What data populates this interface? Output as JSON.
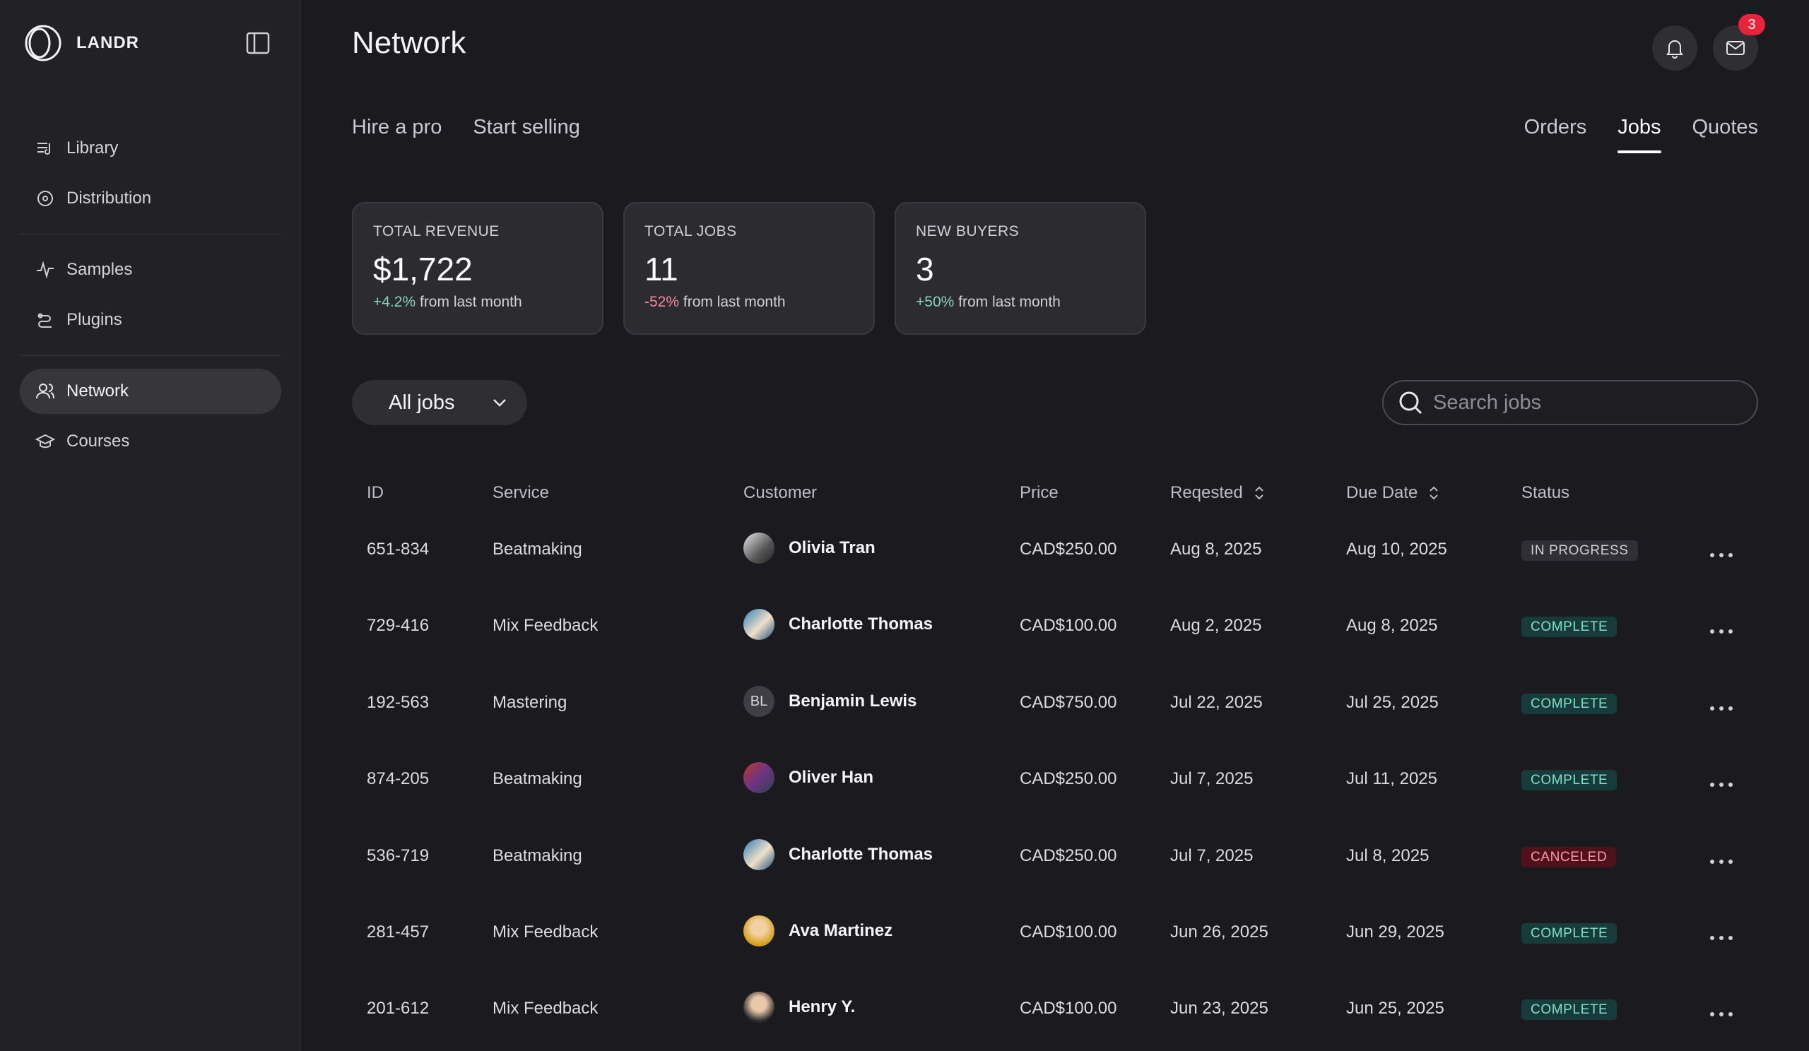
{
  "brand": {
    "name": "LANDR"
  },
  "sidebar": {
    "items": [
      {
        "label": "Library",
        "icon": "library-icon"
      },
      {
        "label": "Distribution",
        "icon": "distribution-icon"
      },
      {
        "label": "Samples",
        "icon": "samples-icon"
      },
      {
        "label": "Plugins",
        "icon": "plugins-icon"
      },
      {
        "label": "Network",
        "icon": "network-icon",
        "active": true
      },
      {
        "label": "Courses",
        "icon": "courses-icon"
      }
    ]
  },
  "header": {
    "title": "Network",
    "notifications_icon": "bell-icon",
    "messages_icon": "mail-icon",
    "messages_badge": "3"
  },
  "subnav": {
    "items": [
      "Hire a pro",
      "Start selling"
    ]
  },
  "tabs": {
    "items": [
      "Orders",
      "Jobs",
      "Quotes"
    ],
    "active": "Jobs"
  },
  "stats": [
    {
      "label": "TOTAL REVENUE",
      "value": "$1,722",
      "change": "+4.2%",
      "change_suffix": "from last month",
      "trend": "positive"
    },
    {
      "label": "TOTAL JOBS",
      "value": "11",
      "change": "-52%",
      "change_suffix": "from last month",
      "trend": "negative"
    },
    {
      "label": "NEW BUYERS",
      "value": "3",
      "change": "+50%",
      "change_suffix": "from last month",
      "trend": "positive"
    }
  ],
  "filter": {
    "selected": "All jobs"
  },
  "search": {
    "placeholder": "Search jobs",
    "value": ""
  },
  "table": {
    "headers": {
      "id": "ID",
      "service": "Service",
      "customer": "Customer",
      "price": "Price",
      "requested": "Reqested",
      "due": "Due Date",
      "status": "Status"
    },
    "rows": [
      {
        "id": "651-834",
        "service": "Beatmaking",
        "customer": "Olivia Tran",
        "avatar": "photo",
        "price": "CAD$250.00",
        "requested": "Aug 8, 2025",
        "due": "Aug 10, 2025",
        "status": "IN PROGRESS"
      },
      {
        "id": "729-416",
        "service": "Mix Feedback",
        "customer": "Charlotte Thomas",
        "avatar": "photo",
        "price": "CAD$100.00",
        "requested": "Aug 2, 2025",
        "due": "Aug 8, 2025",
        "status": "COMPLETE"
      },
      {
        "id": "192-563",
        "service": "Mastering",
        "customer": "Benjamin Lewis",
        "avatar": "BL",
        "price": "CAD$750.00",
        "requested": "Jul 22, 2025",
        "due": "Jul 25, 2025",
        "status": "COMPLETE"
      },
      {
        "id": "874-205",
        "service": "Beatmaking",
        "customer": "Oliver Han",
        "avatar": "photo",
        "price": "CAD$250.00",
        "requested": "Jul 7, 2025",
        "due": "Jul 11, 2025",
        "status": "COMPLETE"
      },
      {
        "id": "536-719",
        "service": "Beatmaking",
        "customer": "Charlotte Thomas",
        "avatar": "photo",
        "price": "CAD$250.00",
        "requested": "Jul 7, 2025",
        "due": "Jul 8, 2025",
        "status": "CANCELED"
      },
      {
        "id": "281-457",
        "service": "Mix Feedback",
        "customer": "Ava Martinez",
        "avatar": "photo",
        "price": "CAD$100.00",
        "requested": "Jun 26, 2025",
        "due": "Jun 29, 2025",
        "status": "COMPLETE"
      },
      {
        "id": "201-612",
        "service": "Mix Feedback",
        "customer": "Henry Y.",
        "avatar": "photo",
        "price": "CAD$100.00",
        "requested": "Jun 23, 2025",
        "due": "Jun 25, 2025",
        "status": "COMPLETE"
      }
    ]
  },
  "colors": {
    "background": "#1b1b1f",
    "sidebar": "#222226",
    "complete": "#7fe0c8",
    "canceled": "#ff9aa8",
    "badge": "#e8233a"
  }
}
